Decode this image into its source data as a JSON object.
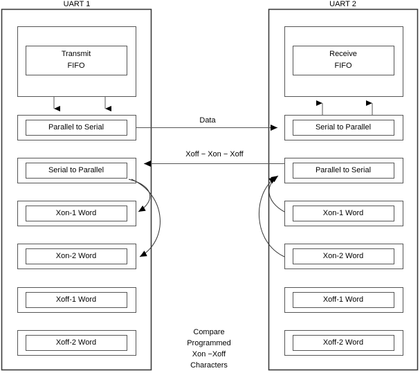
{
  "diagram": {
    "title_left": "UART 1",
    "title_right": "UART 2",
    "link_data_label": "Data",
    "link_flow_label": "Xoff  − Xon  − Xoff",
    "center_note_lines": [
      "Compare",
      "Programmed",
      "Xon −Xoff",
      "Characters"
    ],
    "center_note_line1": "Compare",
    "center_note_line2": "Programmed",
    "center_note_line3": "Xon −Xoff",
    "center_note_line4": "Characters",
    "colors": {
      "outline": "#3a3a3a",
      "box_stroke": "#555555",
      "inner_stroke": "#555555",
      "line": "#555555",
      "arrow_fill": "#000000",
      "text": "#000000",
      "background": "#ffffff"
    },
    "uart1": {
      "name": "UART 1",
      "fifo_line1": "Transmit",
      "fifo_line2": "FIFO",
      "blocks": [
        {
          "id": "parallel-to-serial",
          "label": "Parallel to Serial"
        },
        {
          "id": "serial-to-parallel",
          "label": "Serial to Parallel"
        },
        {
          "id": "xon-1-word",
          "label": "Xon-1 Word"
        },
        {
          "id": "xon-2-word",
          "label": "Xon-2 Word"
        },
        {
          "id": "xoff-1-word",
          "label": "Xoff-1 Word"
        },
        {
          "id": "xoff-2-word",
          "label": "Xoff-2 Word"
        }
      ]
    },
    "uart2": {
      "name": "UART 2",
      "fifo_line1": "Receive",
      "fifo_line2": "FIFO",
      "blocks": [
        {
          "id": "serial-to-parallel",
          "label": "Serial to Parallel"
        },
        {
          "id": "parallel-to-serial",
          "label": "Parallel to Serial"
        },
        {
          "id": "xon-1-word",
          "label": "Xon-1 Word"
        },
        {
          "id": "xon-2-word",
          "label": "Xon-2 Word"
        },
        {
          "id": "xoff-1-word",
          "label": "Xoff-1 Word"
        },
        {
          "id": "xoff-2-word",
          "label": "Xoff-2 Word"
        }
      ]
    }
  }
}
